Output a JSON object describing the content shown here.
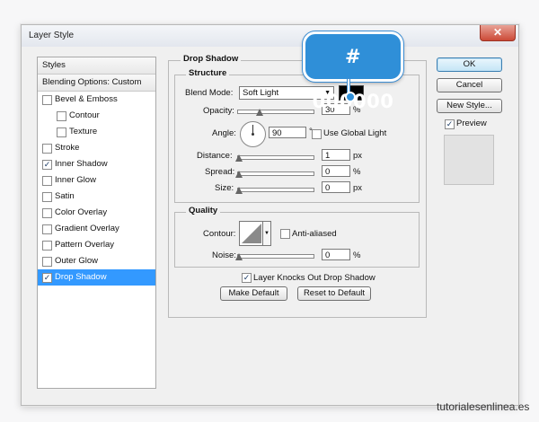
{
  "window": {
    "title": "Layer Style",
    "close_glyph": "✕"
  },
  "callout": {
    "text": "# 000000",
    "color": "#2f8fd8"
  },
  "sidebar": {
    "header": "Styles",
    "blending": "Blending Options: Custom",
    "items": [
      {
        "label": "Bevel & Emboss",
        "checked": false
      },
      {
        "label": "Contour",
        "checked": false,
        "sub": true
      },
      {
        "label": "Texture",
        "checked": false,
        "sub": true
      },
      {
        "label": "Stroke",
        "checked": false
      },
      {
        "label": "Inner Shadow",
        "checked": true
      },
      {
        "label": "Inner Glow",
        "checked": false
      },
      {
        "label": "Satin",
        "checked": false
      },
      {
        "label": "Color Overlay",
        "checked": false
      },
      {
        "label": "Gradient Overlay",
        "checked": false
      },
      {
        "label": "Pattern Overlay",
        "checked": false
      },
      {
        "label": "Outer Glow",
        "checked": false
      },
      {
        "label": "Drop Shadow",
        "checked": true,
        "selected": true
      }
    ],
    "selected_color": "#3399ff"
  },
  "drop_shadow": {
    "group_title": "Drop Shadow",
    "structure_title": "Structure",
    "blend_mode_label": "Blend Mode:",
    "blend_mode_value": "Soft Light",
    "shadow_color": "#000000",
    "opacity_label": "Opacity:",
    "opacity_value": "30",
    "opacity_pct": 0.3,
    "angle_label": "Angle:",
    "angle_value": "90",
    "angle_unit": "°",
    "use_global_light": "Use Global Light",
    "distance_label": "Distance:",
    "distance_value": "1",
    "distance_unit": "px",
    "spread_label": "Spread:",
    "spread_value": "0",
    "spread_unit": "%",
    "size_label": "Size:",
    "size_value": "0",
    "size_unit": "px",
    "percent_unit": "%"
  },
  "quality": {
    "title": "Quality",
    "contour_label": "Contour:",
    "anti_aliased": "Anti-aliased",
    "noise_label": "Noise:",
    "noise_value": "0",
    "noise_unit": "%"
  },
  "footer": {
    "knocks_out": "Layer Knocks Out Drop Shadow",
    "make_default": "Make Default",
    "reset_default": "Reset to Default"
  },
  "buttons": {
    "ok": "OK",
    "cancel": "Cancel",
    "new_style": "New Style...",
    "preview": "Preview"
  },
  "watermark": "tutorialesenlinea.es"
}
